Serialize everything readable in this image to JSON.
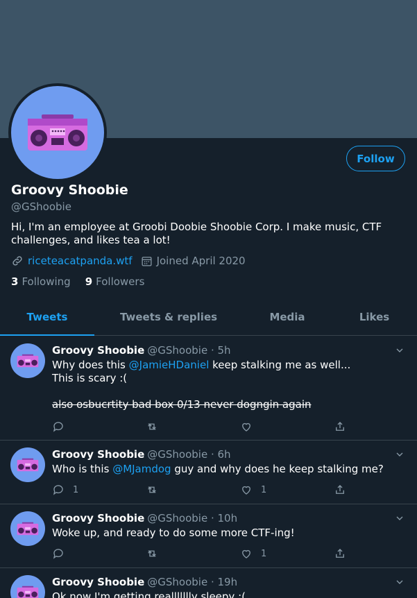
{
  "profile": {
    "name": "Groovy Shoobie",
    "handle": "@GShoobie",
    "bio": "Hi, I'm an employee at Groobi Doobie Shoobie Corp. I make music, CTF challenges, and likes tea a lot!",
    "website": "riceteacatpanda.wtf",
    "joined": "Joined April 2020",
    "following_count": "3",
    "following_label": "Following",
    "followers_count": "9",
    "followers_label": "Followers",
    "follow_label": "Follow",
    "avatar_icon": "boombox-icon"
  },
  "tabs": [
    {
      "label": "Tweets",
      "active": true
    },
    {
      "label": "Tweets & replies",
      "active": false
    },
    {
      "label": "Media",
      "active": false
    },
    {
      "label": "Likes",
      "active": false
    }
  ],
  "tweets": [
    {
      "name": "Groovy Shoobie",
      "meta": "@GShoobie · 5h",
      "line1_pre": "Why does this ",
      "line1_mention": "@JamieHDaniel",
      "line1_post": " keep stalking me as well...",
      "line2": "This is scary :(",
      "strike": "also osbucrtity bad box 0/13 never dogngin again ",
      "replies": "",
      "retweets": "",
      "likes": ""
    },
    {
      "name": "Groovy Shoobie",
      "meta": "@GShoobie · 6h",
      "line1_pre": "Who is this ",
      "line1_mention": "@MJamdog",
      "line1_post": " guy and why does he keep stalking me?",
      "replies": "1",
      "retweets": "",
      "likes": "1"
    },
    {
      "name": "Groovy Shoobie",
      "meta": "@GShoobie · 10h",
      "text": "Woke up, and ready to do some more CTF-ing!",
      "replies": "",
      "retweets": "",
      "likes": "1"
    },
    {
      "name": "Groovy Shoobie",
      "meta": "@GShoobie · 19h",
      "text": "Ok now I'm getting reallllllly sleepy :("
    }
  ],
  "colors": {
    "background": "#15202b",
    "banner": "#3d5466",
    "accent": "#1da1f2",
    "secondary_text": "#8899a6",
    "avatar_bg": "#6f9cf0",
    "boombox": "#d66be0"
  }
}
